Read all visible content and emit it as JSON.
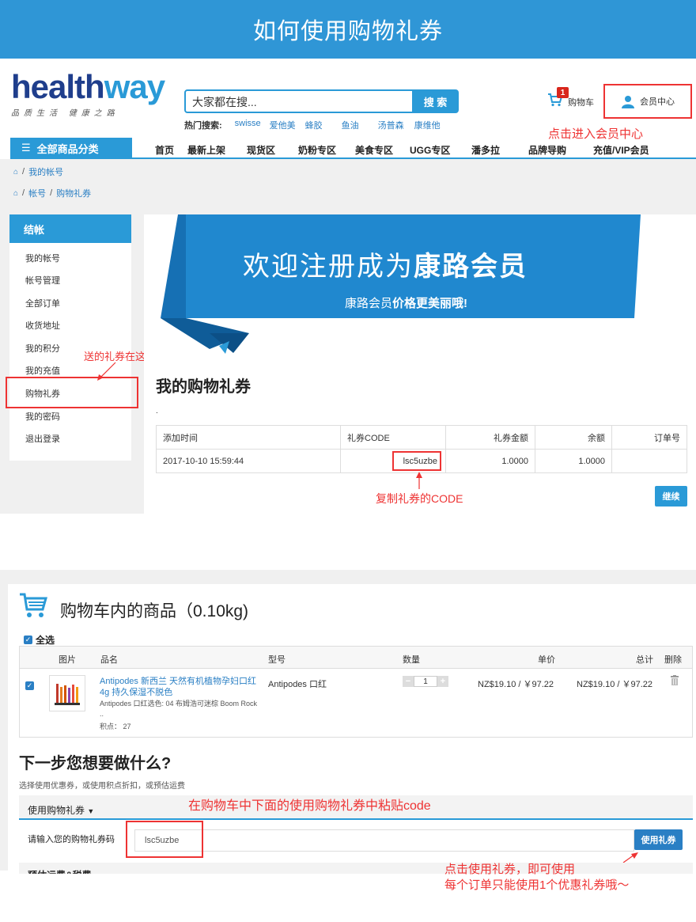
{
  "page_title": "如何使用购物礼券",
  "logo": {
    "main_a": "health",
    "main_b": "way",
    "sub": "品质生活 健康之路"
  },
  "search": {
    "placeholder": "大家都在搜...",
    "button": "搜 索"
  },
  "hot_search": {
    "label": "热门搜索:",
    "keywords": [
      "swisse",
      "爱他美",
      "蜂胶",
      "鱼油",
      "汤普森",
      "康维他"
    ]
  },
  "cart": {
    "count": "1",
    "label": "购物车"
  },
  "member_center": {
    "label": "会员中心"
  },
  "notes": {
    "member": "点击进入会员中心",
    "coupon_here": "送的礼券在这里查看",
    "copy_code": "复制礼券的CODE",
    "paste_code": "在购物车中下面的使用购物礼券中粘贴code",
    "use_line1": "点击使用礼券，即可使用",
    "use_line2": "每个订单只能使用1个优惠礼券哦～"
  },
  "nav": {
    "all_categories": "全部商品分类",
    "items": [
      "首页",
      "最新上架",
      "现货区",
      "奶粉专区",
      "美食专区",
      "UGG专区",
      "潘多拉",
      "品牌导购",
      "充值/VIP会员"
    ]
  },
  "breadcrumbs": {
    "row1": [
      "我的帐号"
    ],
    "row2": [
      "帐号",
      "购物礼券"
    ]
  },
  "sidebar": {
    "head": "结帐",
    "items": [
      "我的帐号",
      "帐号管理",
      "全部订单",
      "收货地址",
      "我的积分",
      "我的充值",
      "购物礼券",
      "我的密码",
      "退出登录"
    ]
  },
  "banner": {
    "title_a": "欢迎注册成为",
    "title_b": "康路会员",
    "sub_a": "康路会员",
    "sub_b": "价格更美丽哦!"
  },
  "voucher": {
    "title": "我的购物礼券",
    "dot": ".",
    "headers": [
      "添加时间",
      "礼券CODE",
      "礼券金额",
      "余额",
      "订单号"
    ],
    "row": {
      "time": "2017-10-10 15:59:44",
      "code": "lsc5uzbe",
      "amount": "1.0000",
      "balance": "1.0000",
      "order": ""
    },
    "continue": "继续"
  },
  "cart_section": {
    "title": "购物车内的商品（0.10kg)",
    "select_all": "全选",
    "headers": [
      "图片",
      "品名",
      "型号",
      "数量",
      "单价",
      "总计",
      "删除"
    ],
    "item": {
      "name": "Antipodes 新西兰 天然有机植物孕妇口红4g 持久保湿不脱色",
      "desc": "Antipodes 口红选色: 04 布姆浩可迷棕 Boom Rock ..",
      "points_label": "积点：",
      "points": "27",
      "model": "Antipodes 口红",
      "qty": "1",
      "minus": "−",
      "plus": "+",
      "unit_price": "NZ$19.10 / ￥97.22",
      "total": "NZ$19.10 / ￥97.22"
    }
  },
  "next_step": {
    "title": "下一步您想要做什么?",
    "sub": "选择使用优惠券，或使用积点折扣，或预估运费",
    "coupon_bar": "使用购物礼券",
    "coupon_label": "请输入您的购物礼券码",
    "coupon_value": "lsc5uzbe",
    "use_button": "使用礼券",
    "estimate_bar": "预估运费&税费"
  }
}
